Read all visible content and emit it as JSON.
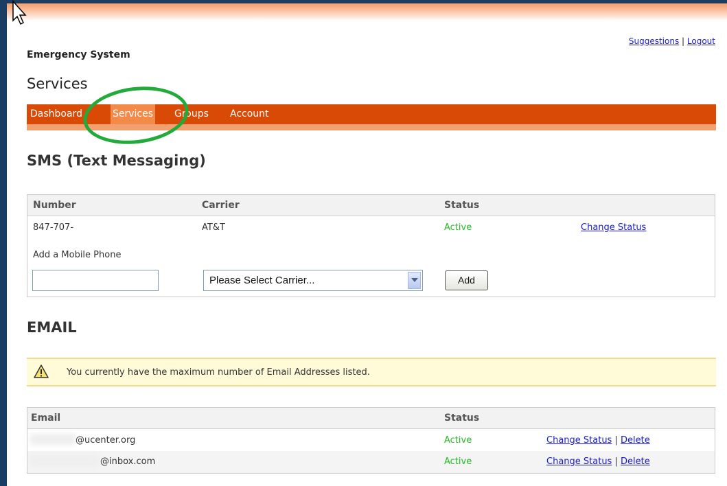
{
  "header": {
    "brand": "Emergency System",
    "links": {
      "suggestions": "Suggestions",
      "separator": "|",
      "logout": "Logout"
    },
    "page_title": "Services"
  },
  "nav": {
    "items": [
      {
        "label": "Dashboard"
      },
      {
        "label": "Services",
        "active": true
      },
      {
        "label": "Groups"
      },
      {
        "label": "Account"
      }
    ]
  },
  "sms": {
    "title": "SMS (Text Messaging)",
    "columns": {
      "number": "Number",
      "carrier": "Carrier",
      "status": "Status"
    },
    "rows": [
      {
        "number": "847-707-",
        "carrier": "AT&T",
        "status": "Active",
        "action": "Change Status"
      }
    ],
    "add_label": "Add a Mobile Phone",
    "phone_value": "",
    "carrier_select": "Please Select Carrier...",
    "add_button": "Add"
  },
  "email": {
    "title": "EMAIL",
    "warning": "You currently have the maximum number of Email Addresses listed.",
    "columns": {
      "email": "Email",
      "status": "Status"
    },
    "rows": [
      {
        "email": "@ucenter.org",
        "status": "Active",
        "action1": "Change Status",
        "sep": "|",
        "action2": "Delete"
      },
      {
        "email": "@inbox.com",
        "status": "Active",
        "action1": "Change Status",
        "sep": "|",
        "action2": "Delete"
      }
    ]
  },
  "colors": {
    "nav_bg": "#d94a06",
    "nav_active": "#f28a4a",
    "active_status": "#22bb22",
    "link": "#1a1ad6",
    "highlight_ring": "#22aa3a"
  }
}
